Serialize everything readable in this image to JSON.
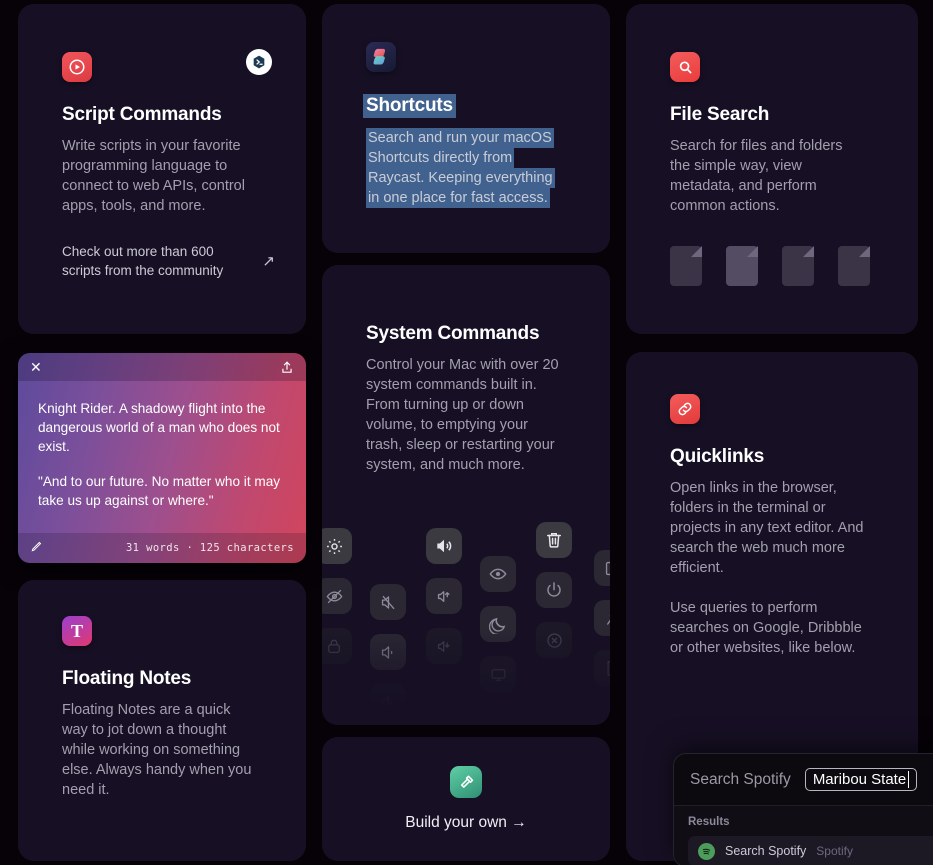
{
  "page": {
    "background": "#060208",
    "card_background": "#171025",
    "selection_color": "#41628f"
  },
  "cards": {
    "script_commands": {
      "icon": "play-circle-icon",
      "icon_color": "#e8484a",
      "badge_icon": "script-badge-icon",
      "title": "Script Commands",
      "body": "Write scripts in your favorite programming language to connect to web APIs, control apps, tools, and more.",
      "link_text": "Check out more than 600 scripts from the community",
      "link_icon": "arrow-up-right-icon"
    },
    "shortcuts": {
      "icon": "shortcuts-app-icon",
      "title": "Shortcuts",
      "body_lines": [
        "Search and run your macOS",
        "Shortcuts directly from",
        "Raycast. Keeping everything",
        "in one place for fast access."
      ],
      "selected": true
    },
    "file_search": {
      "icon": "magnifier-icon",
      "icon_color": "#ef4444",
      "title": "File Search",
      "body": "Search for files and folders the simple way, view metadata, and perform common actions.",
      "documents": [
        "document-icon",
        "document-icon",
        "document-icon",
        "document-icon"
      ]
    },
    "system_commands": {
      "title": "System Commands",
      "body": "Control your Mac with over 20 system commands built in. From turning up or down volume, to emptying your trash, sleep or restarting your system, and much more.",
      "icon_grid": [
        [
          "gear-icon",
          "eye-slash-icon",
          "lock-icon"
        ],
        [
          "speaker-mute-icon",
          "speaker-low-icon",
          "speaker-wave-icon"
        ],
        [
          "speaker-loud-icon",
          "speaker-up-icon",
          "speaker-down-icon"
        ],
        [
          "eye-icon",
          "moon-icon",
          "display-icon"
        ],
        [
          "trash-icon",
          "power-icon",
          "circle-x-icon"
        ],
        [
          "logout-icon",
          "sparkle-icon",
          "file-icon"
        ]
      ]
    },
    "quicklinks": {
      "icon": "link-icon",
      "icon_color": "#ef4444",
      "title": "Quicklinks",
      "body_1": "Open links in the browser, folders in the terminal or projects in any text editor. And search the web much more efficient.",
      "body_2": "Use queries to perform searches on Google, Dribbble or other websites, like below."
    },
    "floating_notes": {
      "icon": "text-T-icon",
      "title": "Floating Notes",
      "body": "Floating Notes are a quick way to jot down a thought while working on something else. Always handy when you need it."
    },
    "build_your_own": {
      "icon": "hammer-icon",
      "label": "Build your own →"
    }
  },
  "note_widget": {
    "close_icon": "close-icon",
    "share_icon": "share-icon",
    "edit_icon": "pencil-icon",
    "paragraph_1": "Knight Rider. A shadowy flight into the dangerous world of a man who does not exist.",
    "paragraph_2": "\"And to our future. No matter who it may take us up against or where.\"",
    "counter": "31 words · 125 characters"
  },
  "spotify_panel": {
    "command_label": "Search Spotify",
    "query_value": "Maribou State",
    "section_label": "Results",
    "result_title": "Search Spotify",
    "result_subtitle": "Spotify",
    "result_icon": "spotify-icon"
  }
}
